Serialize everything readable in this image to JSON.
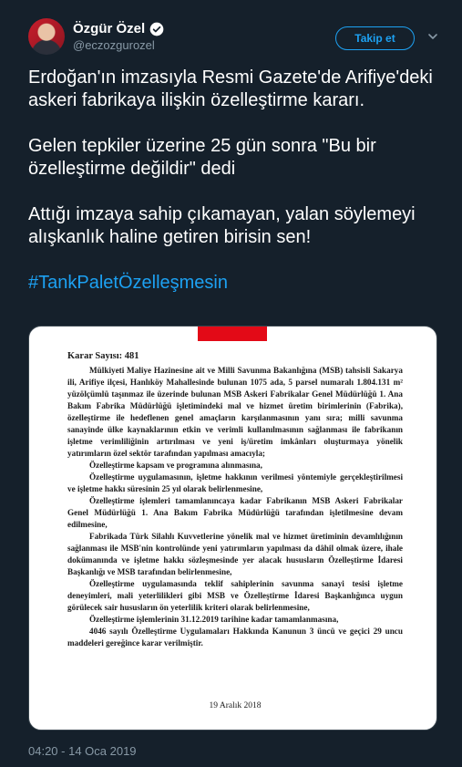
{
  "author": {
    "display_name": "Özgür Özel",
    "handle": "@eczozgurozel",
    "verified": true
  },
  "actions": {
    "follow_label": "Takip et",
    "more_icon": "chevron-down-icon"
  },
  "tweet": {
    "paragraphs": [
      "Erdoğan'ın imzasıyla Resmi Gazete'de Arifiye'deki askeri fabrikaya ilişkin özelleştirme kararı.",
      "Gelen tepkiler üzerine 25 gün sonra \"Bu bir özelleştirme değildir\" dedi",
      "Attığı imzaya sahip çıkamayan, yalan söylemeyi alışkanlık haline getiren birisin sen!"
    ],
    "hashtag": "#TankPaletÖzelleşmesin",
    "timestamp": "04:20 - 14 Oca 2019"
  },
  "document": {
    "heading": "Karar Sayısı: 481",
    "paragraphs": [
      "Mülkiyeti Maliye Hazinesine ait ve Milli Savunma Bakanlığına (MSB) tahsisli Sakarya ili, Arifiye ilçesi, Hanlıköy Mahallesinde bulunan 1075 ada, 5 parsel numaralı 1.804.131 m² yüzölçümlü taşınmaz ile üzerinde bulunan MSB Askeri Fabrikalar Genel Müdürlüğü 1. Ana Bakım Fabrika Müdürlüğü işletimindeki mal ve hizmet üretim birimlerinin (Fabrika), özelleştirme ile hedeflenen genel amaçların karşılanmasının yanı sıra; milli savunma sanayinde ülke kaynaklarının etkin ve verimli kullanılmasının sağlanması ile fabrikanın işletme verimliliğinin artırılması ve yeni iş/üretim imkânları oluşturmaya yönelik yatırımların özel sektör tarafından yapılması amacıyla;",
      "Özelleştirme kapsam ve programına alınmasına,",
      "Özelleştirme uygulamasının, işletme hakkının verilmesi yöntemiyle gerçekleştirilmesi ve işletme hakkı süresinin 25 yıl olarak belirlenmesine,",
      "Özelleştirme işlemleri tamamlanıncaya kadar Fabrikanın MSB Askeri Fabrikalar Genel Müdürlüğü 1. Ana Bakım Fabrika Müdürlüğü tarafından işletilmesine devam edilmesine,",
      "Fabrikada Türk Silahlı Kuvvetlerine yönelik mal ve hizmet üretiminin devamlılığının sağlanması ile MSB'nin kontrolünde yeni yatırımların yapılması da dâhil olmak üzere, ihale dokümanında ve işletme hakkı sözleşmesinde yer alacak hususların Özelleştirme İdaresi Başkanlığı ve MSB tarafından belirlenmesine,",
      "Özelleştirme uygulamasında teklif sahiplerinin savunma sanayi tesisi işletme deneyimleri, mali yeterlilikleri gibi MSB ve Özelleştirme İdaresi Başkanlığınca uygun görülecek sair hususların ön yeterlilik kriteri olarak belirlenmesine,",
      "Özelleştirme işlemlerinin 31.12.2019 tarihine kadar tamamlanmasına,",
      "4046 sayılı Özelleştirme Uygulamaları Hakkında Kanunun 3 üncü ve geçici 29 uncu maddeleri gereğince karar verilmiştir."
    ],
    "date": "19 Aralık 2018"
  }
}
